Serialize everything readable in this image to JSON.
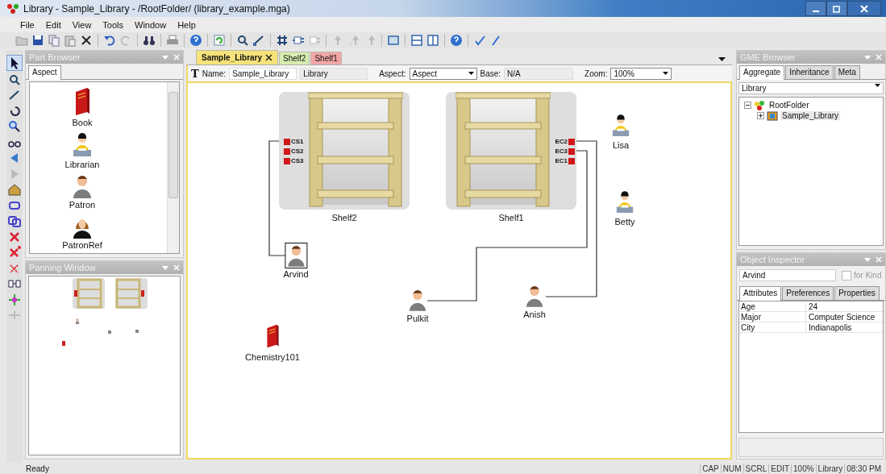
{
  "window": {
    "title": "Library - Sample_Library - /RootFolder/ (library_example.mga)"
  },
  "menu": [
    "File",
    "Edit",
    "View",
    "Tools",
    "Window",
    "Help"
  ],
  "part_browser": {
    "title": "Part Browser",
    "tabs": [
      {
        "label": "Aspect",
        "selected": true
      }
    ],
    "parts": [
      {
        "label": "Book",
        "kind": "book"
      },
      {
        "label": "Librarian",
        "kind": "librarian"
      },
      {
        "label": "Patron",
        "kind": "patron"
      },
      {
        "label": "PatronRef",
        "kind": "patronref"
      }
    ]
  },
  "panning_window": {
    "title": "Panning Window"
  },
  "editor": {
    "tabs": [
      {
        "label": "Sample_Library",
        "selected": true,
        "closable": true,
        "color": "#f6e27a"
      },
      {
        "label": "Shelf2",
        "selected": false,
        "closable": false,
        "color": "#d6edb0"
      },
      {
        "label": "Shelf1",
        "selected": false,
        "closable": false,
        "color": "#f2a6a6"
      }
    ],
    "text_tool": "T",
    "name_label": "Name:",
    "name": "Sample_Library",
    "kind": "Library",
    "aspect_label": "Aspect:",
    "aspect": "Aspect",
    "base_label": "Base:",
    "base": "N/A",
    "zoom_label": "Zoom:",
    "zoom": "100%"
  },
  "canvas": {
    "shelves": [
      {
        "label": "Shelf2",
        "kind": "leftports",
        "ports": [
          "CS1",
          "CS2",
          "CS3"
        ]
      },
      {
        "label": "Shelf1",
        "kind": "rightports",
        "ports": [
          "EC2",
          "EC3",
          "EC1"
        ]
      }
    ],
    "nodes": [
      {
        "label": "Lisa",
        "kind": "librarian",
        "selected": false
      },
      {
        "label": "Betty",
        "kind": "librarian",
        "selected": false
      },
      {
        "label": "Arvind",
        "kind": "patron",
        "selected": true
      },
      {
        "label": "Pulkit",
        "kind": "patron",
        "selected": false
      },
      {
        "label": "Anish",
        "kind": "patron",
        "selected": false
      },
      {
        "label": "Chemistry101",
        "kind": "book",
        "selected": false
      }
    ]
  },
  "gme_browser": {
    "title": "GME Browser",
    "tabs": [
      {
        "label": "Aggregate",
        "selected": true
      },
      {
        "label": "Inheritance",
        "selected": false
      },
      {
        "label": "Meta",
        "selected": false
      }
    ],
    "filter": "Library",
    "tree": [
      {
        "label": "RootFolder",
        "expanded": true,
        "selected": false,
        "children": [
          {
            "label": "Sample_Library",
            "expanded": false,
            "selected": true
          }
        ]
      }
    ]
  },
  "object_inspector": {
    "title": "Object Inspector",
    "name": "Arvind",
    "for_kind": {
      "label": "for Kind",
      "checked": false
    },
    "tabs": [
      {
        "label": "Attributes",
        "selected": true
      },
      {
        "label": "Preferences",
        "selected": false
      },
      {
        "label": "Properties",
        "selected": false
      }
    ],
    "attributes": [
      {
        "name": "Age",
        "value": "24"
      },
      {
        "name": "Major",
        "value": "Computer Science"
      },
      {
        "name": "City",
        "value": "Indianapolis"
      }
    ]
  },
  "status_bar": {
    "message": "Ready",
    "indicators": [
      "CAP",
      "NUM",
      "SCRL",
      "EDIT",
      "100%",
      "Library",
      "08:30 PM"
    ]
  }
}
